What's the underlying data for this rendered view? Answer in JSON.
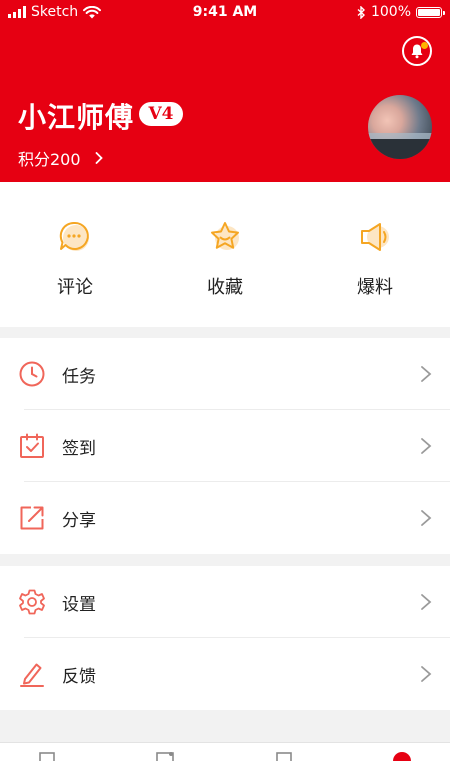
{
  "status_bar": {
    "carrier": "Sketch",
    "time": "9:41 AM",
    "battery_text": "100%"
  },
  "profile": {
    "name": "小江师傅",
    "level": "V4",
    "points_text": "积分200"
  },
  "colors": {
    "brand_red": "#e60012",
    "accent_orange": "#f5a623",
    "icon_red": "#f0665a"
  },
  "quick_actions": [
    {
      "label": "评论",
      "icon": "comment-icon"
    },
    {
      "label": "收藏",
      "icon": "star-icon"
    },
    {
      "label": "爆料",
      "icon": "megaphone-icon"
    }
  ],
  "menu_group1": [
    {
      "label": "任务",
      "icon": "clock-icon"
    },
    {
      "label": "签到",
      "icon": "calendar-check-icon"
    },
    {
      "label": "分享",
      "icon": "share-icon"
    }
  ],
  "menu_group2": [
    {
      "label": "设置",
      "icon": "gear-icon"
    },
    {
      "label": "反馈",
      "icon": "pencil-icon"
    }
  ]
}
